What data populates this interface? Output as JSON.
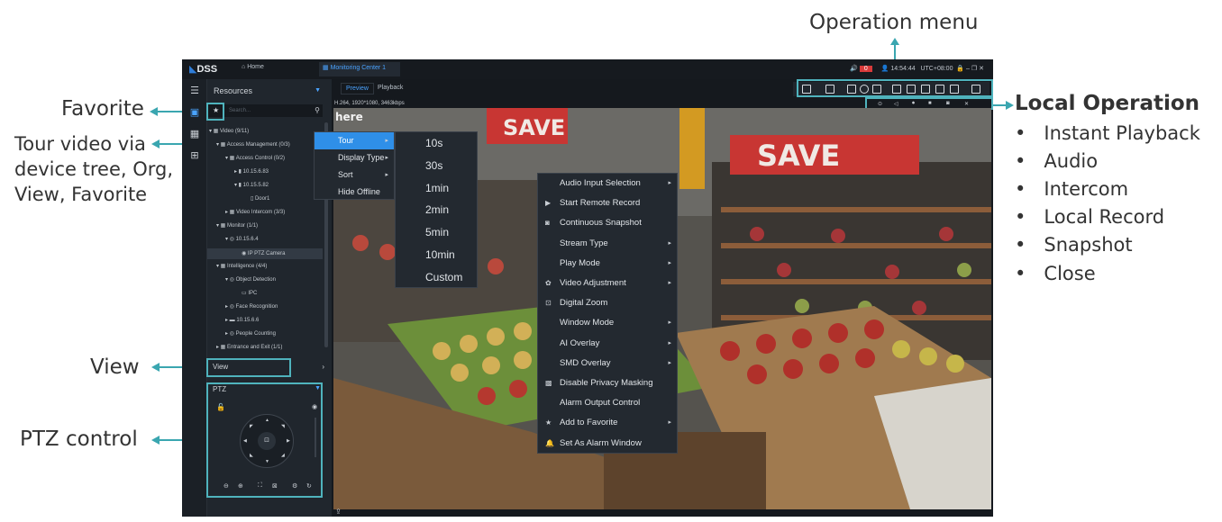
{
  "callouts": {
    "operation_menu": "Operation menu",
    "favorite": "Favorite",
    "tour_video": [
      "Tour video via",
      "device tree, Org,",
      "View, Favorite"
    ],
    "view": "View",
    "ptz_control": "PTZ control",
    "local_operation_title": "Local Operation",
    "local_operation_items": [
      "Instant Playback",
      "Audio",
      "Intercom",
      "Local Record",
      "Snapshot",
      "Close"
    ]
  },
  "app": {
    "logo": "DSS",
    "tabs": {
      "home": "Home",
      "monitoring": "Monitoring Center 1"
    },
    "clock": "14:54:44",
    "timezone": "UTC+08:00",
    "alarm_count": "0"
  },
  "resources": {
    "title": "Resources",
    "search_placeholder": "Search...",
    "tree": [
      "Video (9/11)",
      "Access Management (0/3)",
      "Access Control (0/2)",
      "10.15.6.83",
      "10.15.5.82",
      "Door1",
      "Video Intercom (3/3)",
      "Monitor (1/1)",
      "10.15.6.4",
      "IP PTZ Camera",
      "Intelligence (4/4)",
      "Object Detection",
      "IPC",
      "Face Recognition",
      "10.15.6.6",
      "People Counting",
      "Entrance and Exit (1/1)"
    ],
    "view_label": "View",
    "ptz_label": "PTZ"
  },
  "viewer": {
    "tabs": {
      "preview": "Preview",
      "playback": "Playback"
    },
    "stream_info": "H.264, 1920*1080, 3463kbps"
  },
  "context_menu_tree": [
    "Tour",
    "Display Type",
    "Sort",
    "Hide Offline"
  ],
  "tour_intervals": [
    "10s",
    "30s",
    "1min",
    "2min",
    "5min",
    "10min",
    "Custom"
  ],
  "video_context_menu": [
    "Audio Input Selection",
    "Start Remote Record",
    "Continuous Snapshot",
    "Stream Type",
    "Play Mode",
    "Video Adjustment",
    "Digital Zoom",
    "Window Mode",
    "AI Overlay",
    "SMD Overlay",
    "Disable Privacy Masking",
    "Alarm Output Control",
    "Add to Favorite",
    "Set As Alarm Window"
  ],
  "video_signs": {
    "save1": "SAVE",
    "save2": "SAVE",
    "here": "here"
  },
  "colors": {
    "accent": "#2f8fe8",
    "callout_teal": "#4fb3bd",
    "panel": "#20262d"
  }
}
